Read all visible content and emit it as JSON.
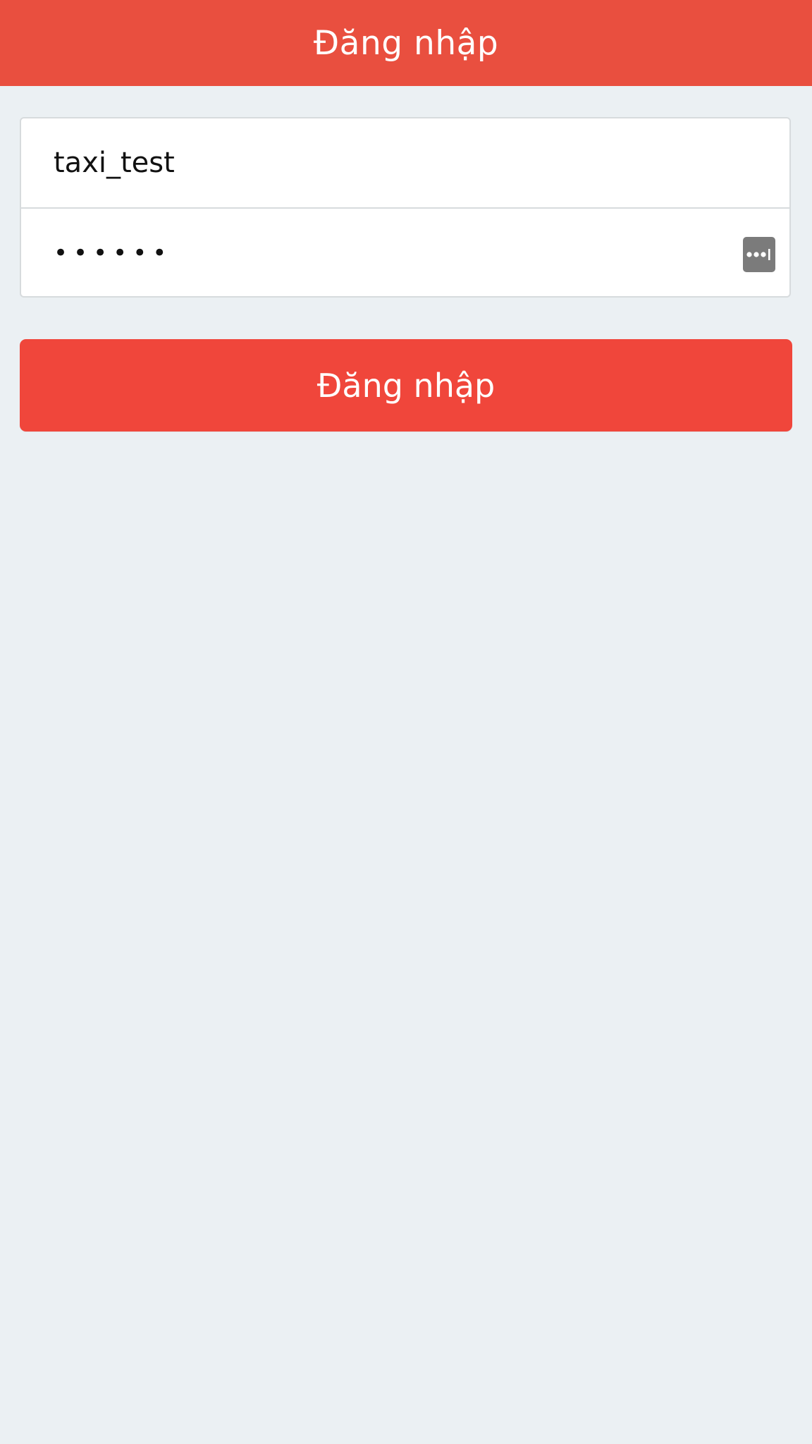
{
  "header": {
    "title": "Đăng nhập",
    "background_color": "#e94f3f"
  },
  "form": {
    "username": {
      "value": "taxi_test"
    },
    "password": {
      "value": "••••••",
      "autofill_icon": "password-key-icon"
    }
  },
  "actions": {
    "login_label": "Đăng nhập",
    "login_color": "#f0463b"
  },
  "page": {
    "background_color": "#ebf0f3"
  }
}
